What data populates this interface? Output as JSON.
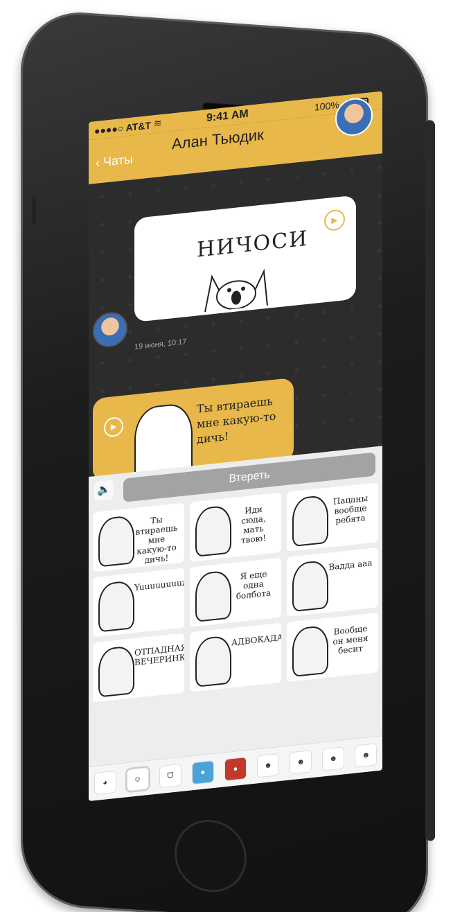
{
  "status_bar": {
    "carrier": "●●●●○ AT&T",
    "time": "9:41 AM",
    "battery_percent": "100%"
  },
  "nav": {
    "back_label": "Чаты",
    "title": "Алан Тьюдик"
  },
  "messages": [
    {
      "sticker_text": "НИЧОСИ",
      "timestamp": "19 июня, 10:17"
    },
    {
      "sticker_text": "Ты втираешь мне какую-то дичь!"
    }
  ],
  "panel": {
    "action_label": "Втереть"
  },
  "stickers": [
    {
      "caption": "Ты втираешь мне какую-то дичь!"
    },
    {
      "caption": "Иди сюда, мать твою!"
    },
    {
      "caption": "Пацаны вообще ребята"
    },
    {
      "caption": "Yuuuuuuuuzzzz"
    },
    {
      "caption": "Я еще одна болбота"
    },
    {
      "caption": "Вадда ааа"
    },
    {
      "caption": "ОТПАДНАЯ ВЕЧЕРИНКАА"
    },
    {
      "caption": "АДВОКАДААТ"
    },
    {
      "caption": "Вообще он меня бесит"
    }
  ],
  "tray_selected_index": 1,
  "colors": {
    "accent": "#e8b84a",
    "chat_bg": "#2c2c2c",
    "panel_bg": "#eceded",
    "action_bg": "#a3a3a3"
  }
}
